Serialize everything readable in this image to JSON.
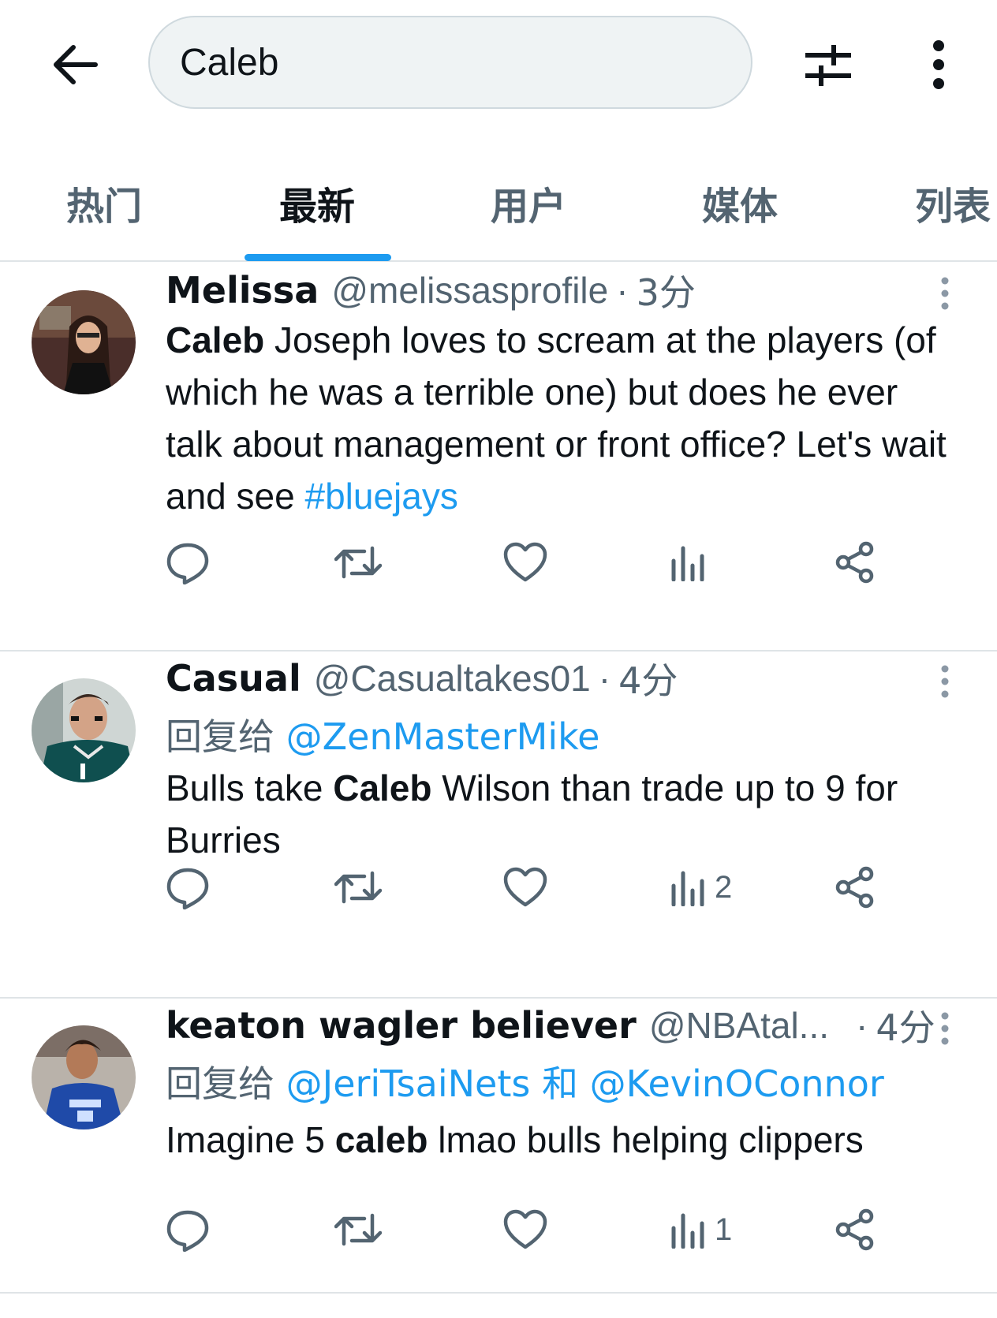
{
  "search": {
    "query": "Caleb"
  },
  "tabs": [
    {
      "label": "热门"
    },
    {
      "label": "最新"
    },
    {
      "label": "用户"
    },
    {
      "label": "媒体"
    },
    {
      "label": "列表"
    }
  ],
  "active_tab": "最新",
  "tweets": [
    {
      "name": "Melissa",
      "handle": "@melissasprofile",
      "separator": "·",
      "time": "3分",
      "text": {
        "bold": "Caleb",
        "rest": " Joseph loves to scream at the players (of which he was a terrible one) but does he ever talk about management or front office? Let's wait and see ",
        "hashtag": "#bluejays"
      },
      "views": ""
    },
    {
      "name": "Casual",
      "handle": "@Casualtakes01",
      "separator": "·",
      "time": "4分",
      "reply_prefix": "回复给",
      "reply_to": "@ZenMasterMike",
      "text": {
        "pre": "Bulls take ",
        "bold": "Caleb",
        "rest": " Wilson than trade up to 9 for Burries"
      },
      "views": "2"
    },
    {
      "name": "keaton wagler believer",
      "handle": "@NBAtal...",
      "separator": "·",
      "time": "4分",
      "reply_prefix": "回复给",
      "reply_to_1": "@JeriTsaiNets",
      "reply_joiner": "和",
      "reply_to_2": "@KevinOConnor",
      "text": {
        "pre": "Imagine 5 ",
        "bold": "caleb",
        "rest": " lmao bulls helping clippers"
      },
      "views": "1"
    }
  ],
  "colors": {
    "accent": "#1d9bf0",
    "secondary_text": "#536471",
    "primary_text": "#0f1419",
    "divider": "#dfe4e7"
  },
  "icons": [
    "back-arrow-icon",
    "filter-sliders-icon",
    "more-vertical-icon",
    "reply-icon",
    "retweet-icon",
    "like-icon",
    "views-icon",
    "share-icon"
  ]
}
